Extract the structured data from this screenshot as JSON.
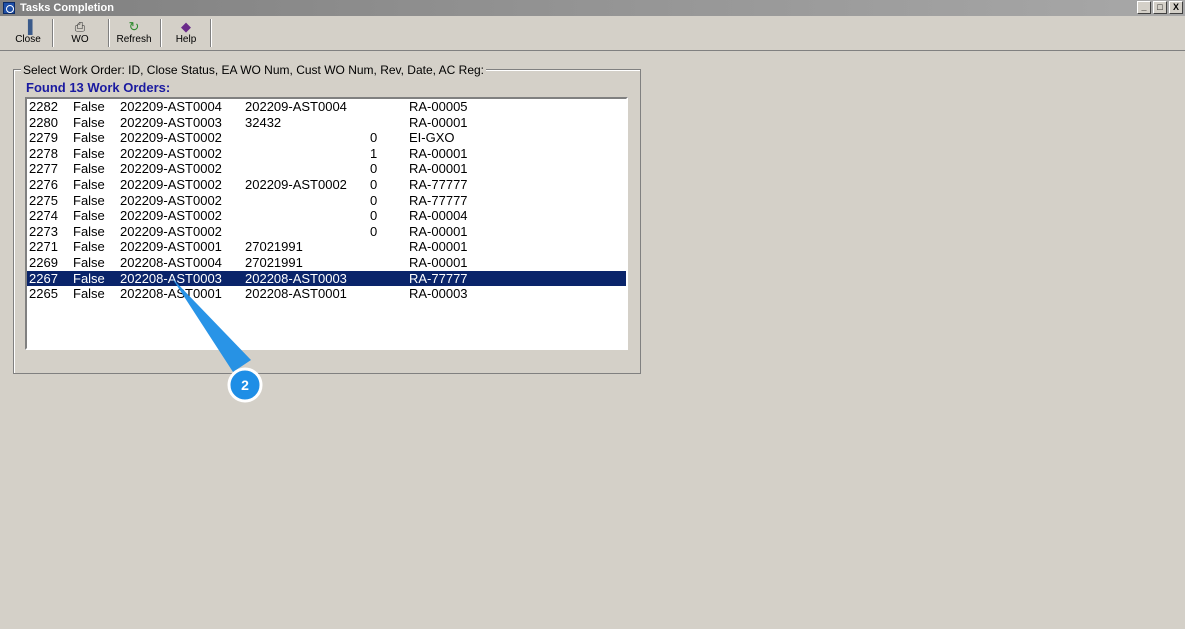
{
  "window": {
    "title": "Tasks Completion",
    "controls": [
      "_",
      "□",
      "X"
    ]
  },
  "toolbar": {
    "buttons": [
      {
        "label": "Close",
        "icon": "exit-door-icon",
        "glyph": "▐"
      },
      {
        "label": "WO",
        "icon": "printer-icon",
        "glyph": "⎙"
      },
      {
        "label": "Refresh",
        "icon": "refresh-arrow-icon",
        "glyph": "↻"
      },
      {
        "label": "Help",
        "icon": "help-book-icon",
        "glyph": "◆"
      }
    ]
  },
  "group": {
    "legend": "Select Work Order: ID, Close Status, EA WO Num, Cust WO Num, Rev, Date, AC Reg:",
    "found_label": "Found 13 Work Orders:"
  },
  "work_orders": [
    {
      "id": "2282",
      "status": "False",
      "ea_wo": "202209-AST0004",
      "cust_wo": "202209-AST0004",
      "rev": "",
      "ac_reg": "RA-00005"
    },
    {
      "id": "2280",
      "status": "False",
      "ea_wo": "202209-AST0003",
      "cust_wo": "32432",
      "rev": "",
      "ac_reg": "RA-00001"
    },
    {
      "id": "2279",
      "status": "False",
      "ea_wo": "202209-AST0002",
      "cust_wo": "",
      "rev": "0",
      "ac_reg": "EI-GXO"
    },
    {
      "id": "2278",
      "status": "False",
      "ea_wo": "202209-AST0002",
      "cust_wo": "",
      "rev": "1",
      "ac_reg": "RA-00001"
    },
    {
      "id": "2277",
      "status": "False",
      "ea_wo": "202209-AST0002",
      "cust_wo": "",
      "rev": "0",
      "ac_reg": "RA-00001"
    },
    {
      "id": "2276",
      "status": "False",
      "ea_wo": "202209-AST0002",
      "cust_wo": "202209-AST0002",
      "rev": "0",
      "ac_reg": "RA-77777"
    },
    {
      "id": "2275",
      "status": "False",
      "ea_wo": "202209-AST0002",
      "cust_wo": "",
      "rev": "0",
      "ac_reg": "RA-77777"
    },
    {
      "id": "2274",
      "status": "False",
      "ea_wo": "202209-AST0002",
      "cust_wo": "",
      "rev": "0",
      "ac_reg": "RA-00004"
    },
    {
      "id": "2273",
      "status": "False",
      "ea_wo": "202209-AST0002",
      "cust_wo": "",
      "rev": "0",
      "ac_reg": "RA-00001"
    },
    {
      "id": "2271",
      "status": "False",
      "ea_wo": "202209-AST0001",
      "cust_wo": "27021991",
      "rev": "",
      "ac_reg": "RA-00001"
    },
    {
      "id": "2269",
      "status": "False",
      "ea_wo": "202208-AST0004",
      "cust_wo": "27021991",
      "rev": "",
      "ac_reg": "RA-00001"
    },
    {
      "id": "2267",
      "status": "False",
      "ea_wo": "202208-AST0003",
      "cust_wo": "202208-AST0003",
      "rev": "",
      "ac_reg": "RA-77777",
      "selected": true
    },
    {
      "id": "2265",
      "status": "False",
      "ea_wo": "202208-AST0001",
      "cust_wo": "202208-AST0001",
      "rev": "",
      "ac_reg": "RA-00003"
    }
  ],
  "callout": {
    "number": "2",
    "color": "#1e8ee6"
  }
}
